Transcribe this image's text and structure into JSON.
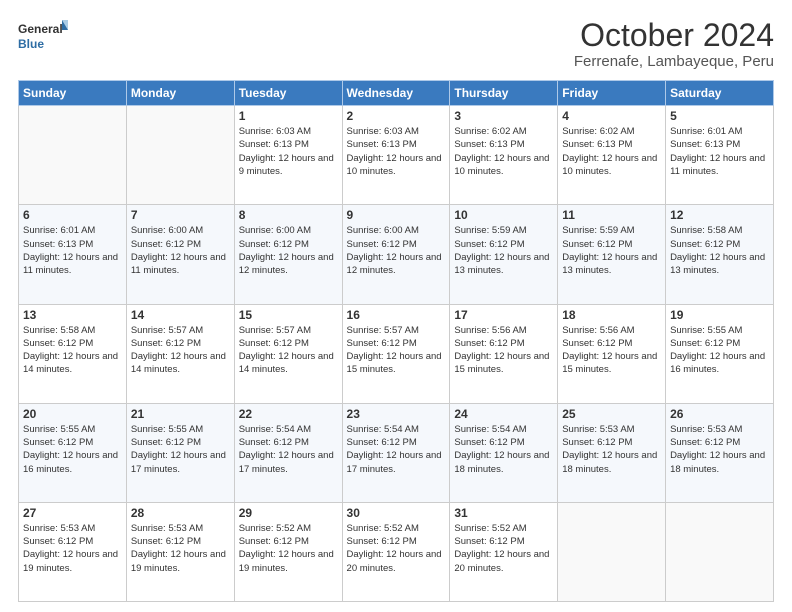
{
  "logo": {
    "line1": "General",
    "line2": "Blue"
  },
  "title": "October 2024",
  "subtitle": "Ferrenafe, Lambayeque, Peru",
  "days_of_week": [
    "Sunday",
    "Monday",
    "Tuesday",
    "Wednesday",
    "Thursday",
    "Friday",
    "Saturday"
  ],
  "weeks": [
    [
      {
        "day": "",
        "info": ""
      },
      {
        "day": "",
        "info": ""
      },
      {
        "day": "1",
        "info": "Sunrise: 6:03 AM\nSunset: 6:13 PM\nDaylight: 12 hours and 9 minutes."
      },
      {
        "day": "2",
        "info": "Sunrise: 6:03 AM\nSunset: 6:13 PM\nDaylight: 12 hours and 10 minutes."
      },
      {
        "day": "3",
        "info": "Sunrise: 6:02 AM\nSunset: 6:13 PM\nDaylight: 12 hours and 10 minutes."
      },
      {
        "day": "4",
        "info": "Sunrise: 6:02 AM\nSunset: 6:13 PM\nDaylight: 12 hours and 10 minutes."
      },
      {
        "day": "5",
        "info": "Sunrise: 6:01 AM\nSunset: 6:13 PM\nDaylight: 12 hours and 11 minutes."
      }
    ],
    [
      {
        "day": "6",
        "info": "Sunrise: 6:01 AM\nSunset: 6:13 PM\nDaylight: 12 hours and 11 minutes."
      },
      {
        "day": "7",
        "info": "Sunrise: 6:00 AM\nSunset: 6:12 PM\nDaylight: 12 hours and 11 minutes."
      },
      {
        "day": "8",
        "info": "Sunrise: 6:00 AM\nSunset: 6:12 PM\nDaylight: 12 hours and 12 minutes."
      },
      {
        "day": "9",
        "info": "Sunrise: 6:00 AM\nSunset: 6:12 PM\nDaylight: 12 hours and 12 minutes."
      },
      {
        "day": "10",
        "info": "Sunrise: 5:59 AM\nSunset: 6:12 PM\nDaylight: 12 hours and 13 minutes."
      },
      {
        "day": "11",
        "info": "Sunrise: 5:59 AM\nSunset: 6:12 PM\nDaylight: 12 hours and 13 minutes."
      },
      {
        "day": "12",
        "info": "Sunrise: 5:58 AM\nSunset: 6:12 PM\nDaylight: 12 hours and 13 minutes."
      }
    ],
    [
      {
        "day": "13",
        "info": "Sunrise: 5:58 AM\nSunset: 6:12 PM\nDaylight: 12 hours and 14 minutes."
      },
      {
        "day": "14",
        "info": "Sunrise: 5:57 AM\nSunset: 6:12 PM\nDaylight: 12 hours and 14 minutes."
      },
      {
        "day": "15",
        "info": "Sunrise: 5:57 AM\nSunset: 6:12 PM\nDaylight: 12 hours and 14 minutes."
      },
      {
        "day": "16",
        "info": "Sunrise: 5:57 AM\nSunset: 6:12 PM\nDaylight: 12 hours and 15 minutes."
      },
      {
        "day": "17",
        "info": "Sunrise: 5:56 AM\nSunset: 6:12 PM\nDaylight: 12 hours and 15 minutes."
      },
      {
        "day": "18",
        "info": "Sunrise: 5:56 AM\nSunset: 6:12 PM\nDaylight: 12 hours and 15 minutes."
      },
      {
        "day": "19",
        "info": "Sunrise: 5:55 AM\nSunset: 6:12 PM\nDaylight: 12 hours and 16 minutes."
      }
    ],
    [
      {
        "day": "20",
        "info": "Sunrise: 5:55 AM\nSunset: 6:12 PM\nDaylight: 12 hours and 16 minutes."
      },
      {
        "day": "21",
        "info": "Sunrise: 5:55 AM\nSunset: 6:12 PM\nDaylight: 12 hours and 17 minutes."
      },
      {
        "day": "22",
        "info": "Sunrise: 5:54 AM\nSunset: 6:12 PM\nDaylight: 12 hours and 17 minutes."
      },
      {
        "day": "23",
        "info": "Sunrise: 5:54 AM\nSunset: 6:12 PM\nDaylight: 12 hours and 17 minutes."
      },
      {
        "day": "24",
        "info": "Sunrise: 5:54 AM\nSunset: 6:12 PM\nDaylight: 12 hours and 18 minutes."
      },
      {
        "day": "25",
        "info": "Sunrise: 5:53 AM\nSunset: 6:12 PM\nDaylight: 12 hours and 18 minutes."
      },
      {
        "day": "26",
        "info": "Sunrise: 5:53 AM\nSunset: 6:12 PM\nDaylight: 12 hours and 18 minutes."
      }
    ],
    [
      {
        "day": "27",
        "info": "Sunrise: 5:53 AM\nSunset: 6:12 PM\nDaylight: 12 hours and 19 minutes."
      },
      {
        "day": "28",
        "info": "Sunrise: 5:53 AM\nSunset: 6:12 PM\nDaylight: 12 hours and 19 minutes."
      },
      {
        "day": "29",
        "info": "Sunrise: 5:52 AM\nSunset: 6:12 PM\nDaylight: 12 hours and 19 minutes."
      },
      {
        "day": "30",
        "info": "Sunrise: 5:52 AM\nSunset: 6:12 PM\nDaylight: 12 hours and 20 minutes."
      },
      {
        "day": "31",
        "info": "Sunrise: 5:52 AM\nSunset: 6:12 PM\nDaylight: 12 hours and 20 minutes."
      },
      {
        "day": "",
        "info": ""
      },
      {
        "day": "",
        "info": ""
      }
    ]
  ]
}
